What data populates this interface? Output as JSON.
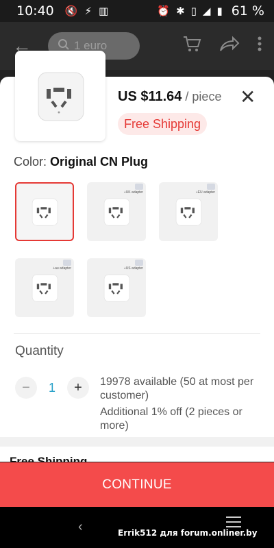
{
  "status_bar": {
    "time": "10:40",
    "battery": "61 %",
    "left_icons": [
      "mute-icon",
      "flash-icon",
      "signal-bars-icon"
    ],
    "right_icons": [
      "alarm-icon",
      "bluetooth-icon",
      "vibrate-icon",
      "mobile-signal-icon",
      "battery-icon"
    ]
  },
  "app_bar": {
    "search_text": "1 euro",
    "icons": [
      "back-arrow-icon",
      "search-icon",
      "cart-icon",
      "share-icon",
      "more-vert-icon"
    ]
  },
  "product": {
    "price": "US $11.64",
    "unit": "/ piece",
    "shipping_badge": "Free Shipping"
  },
  "color": {
    "label": "Color:",
    "selected": "Original CN Plug",
    "options": [
      {
        "name": "Original CN Plug",
        "tag": "",
        "selected": true
      },
      {
        "name": "UK adapter",
        "tag": "+UK adapter",
        "selected": false
      },
      {
        "name": "EU adapter",
        "tag": "+EU adapter",
        "selected": false
      },
      {
        "name": "AU adapter",
        "tag": "+au adapter",
        "selected": false
      },
      {
        "name": "US adapter",
        "tag": "+US adapter",
        "selected": false
      }
    ]
  },
  "quantity": {
    "label": "Quantity",
    "value": "1",
    "minus": "−",
    "plus": "+",
    "available": "19978 available (50 at most per customer)",
    "discount": "Additional 1% off (2 pieces or more)"
  },
  "shipping_peek": "Free Shipping",
  "continue_label": "CONTINUE",
  "watermark": "Errik512 для forum.onliner.by",
  "colors": {
    "accent": "#f44b4b",
    "badge_bg": "#fde9e8",
    "badge_text": "#e53935",
    "qty_value": "#26a0c8"
  }
}
